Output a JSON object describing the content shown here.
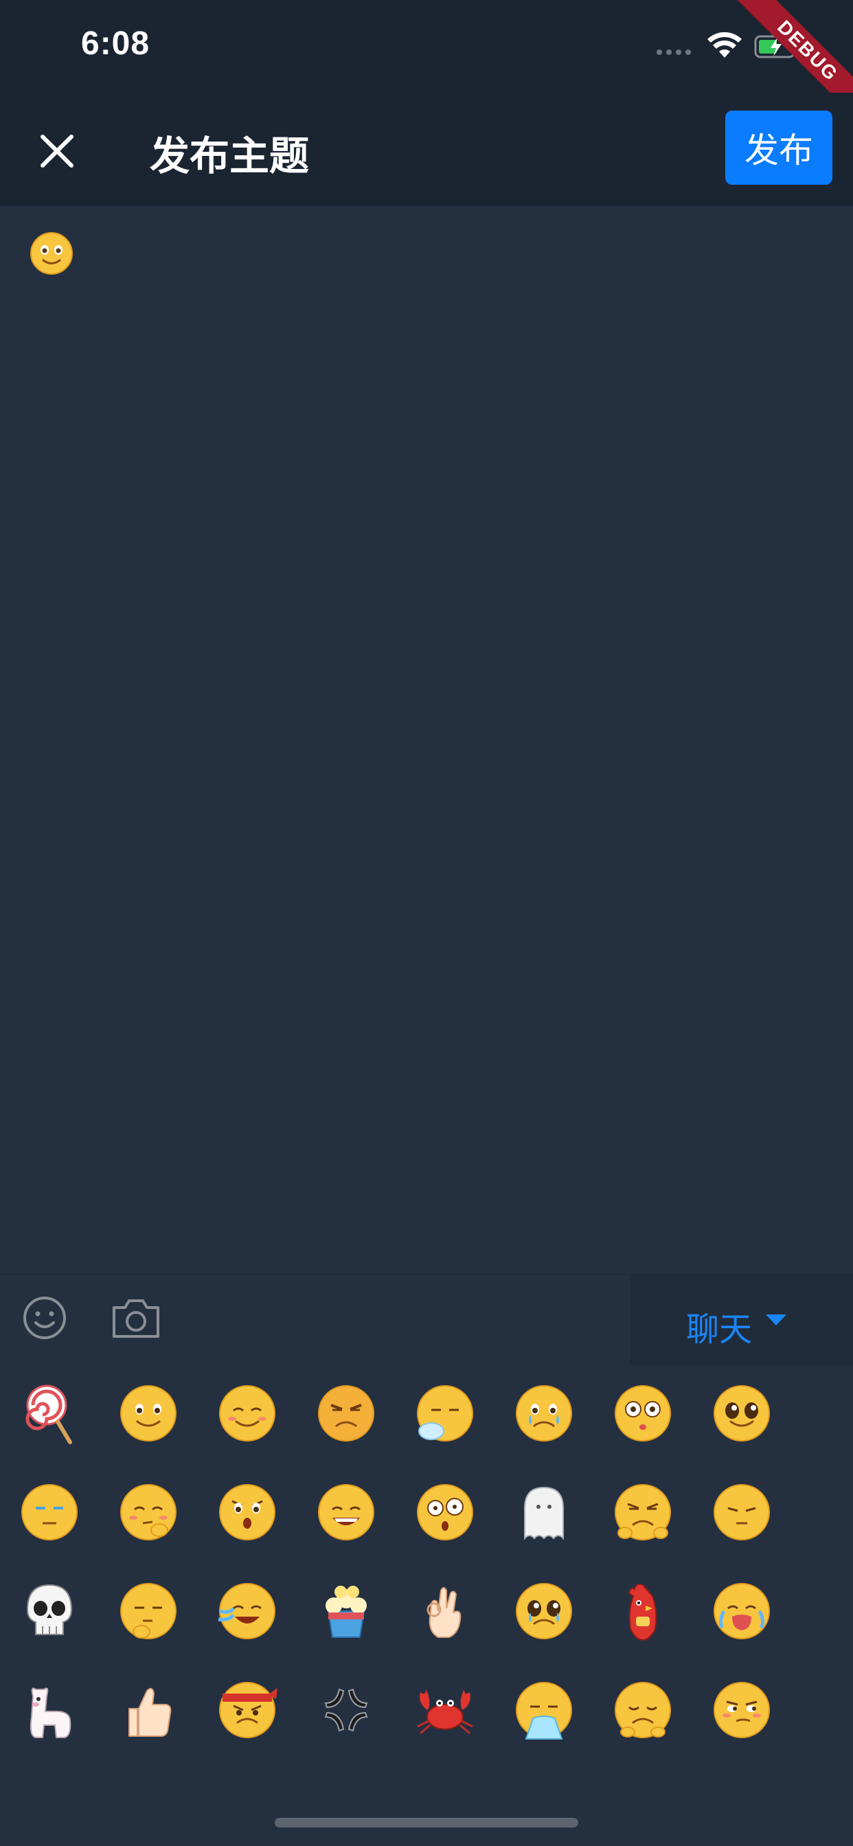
{
  "status_bar": {
    "time": "6:08",
    "debug_label": "DEBUG"
  },
  "app_bar": {
    "title": "发布主题",
    "publish_label": "发布"
  },
  "toolbar": {
    "category_label": "聊天"
  },
  "colors": {
    "background": "#243040",
    "bar": "#1b2431",
    "accent": "#0a7cff"
  },
  "emojis": [
    {
      "name": "lollipop"
    },
    {
      "name": "smile"
    },
    {
      "name": "shy-smile"
    },
    {
      "name": "angry-grumpy"
    },
    {
      "name": "sleepy"
    },
    {
      "name": "teary"
    },
    {
      "name": "surprised"
    },
    {
      "name": "cute-eyes"
    },
    {
      "name": "unamused"
    },
    {
      "name": "thinking"
    },
    {
      "name": "shocked"
    },
    {
      "name": "grin"
    },
    {
      "name": "dizzy"
    },
    {
      "name": "ghost"
    },
    {
      "name": "grumpy-arms"
    },
    {
      "name": "meh"
    },
    {
      "name": "skull"
    },
    {
      "name": "pondering"
    },
    {
      "name": "crying-laugh"
    },
    {
      "name": "popcorn"
    },
    {
      "name": "ok-hand"
    },
    {
      "name": "pleading"
    },
    {
      "name": "rooster"
    },
    {
      "name": "sobbing"
    },
    {
      "name": "alpaca"
    },
    {
      "name": "thumbs-up"
    },
    {
      "name": "headband"
    },
    {
      "name": "anger-mark"
    },
    {
      "name": "crab"
    },
    {
      "name": "vomit"
    },
    {
      "name": "pouting"
    },
    {
      "name": "smug-side-eye"
    }
  ]
}
